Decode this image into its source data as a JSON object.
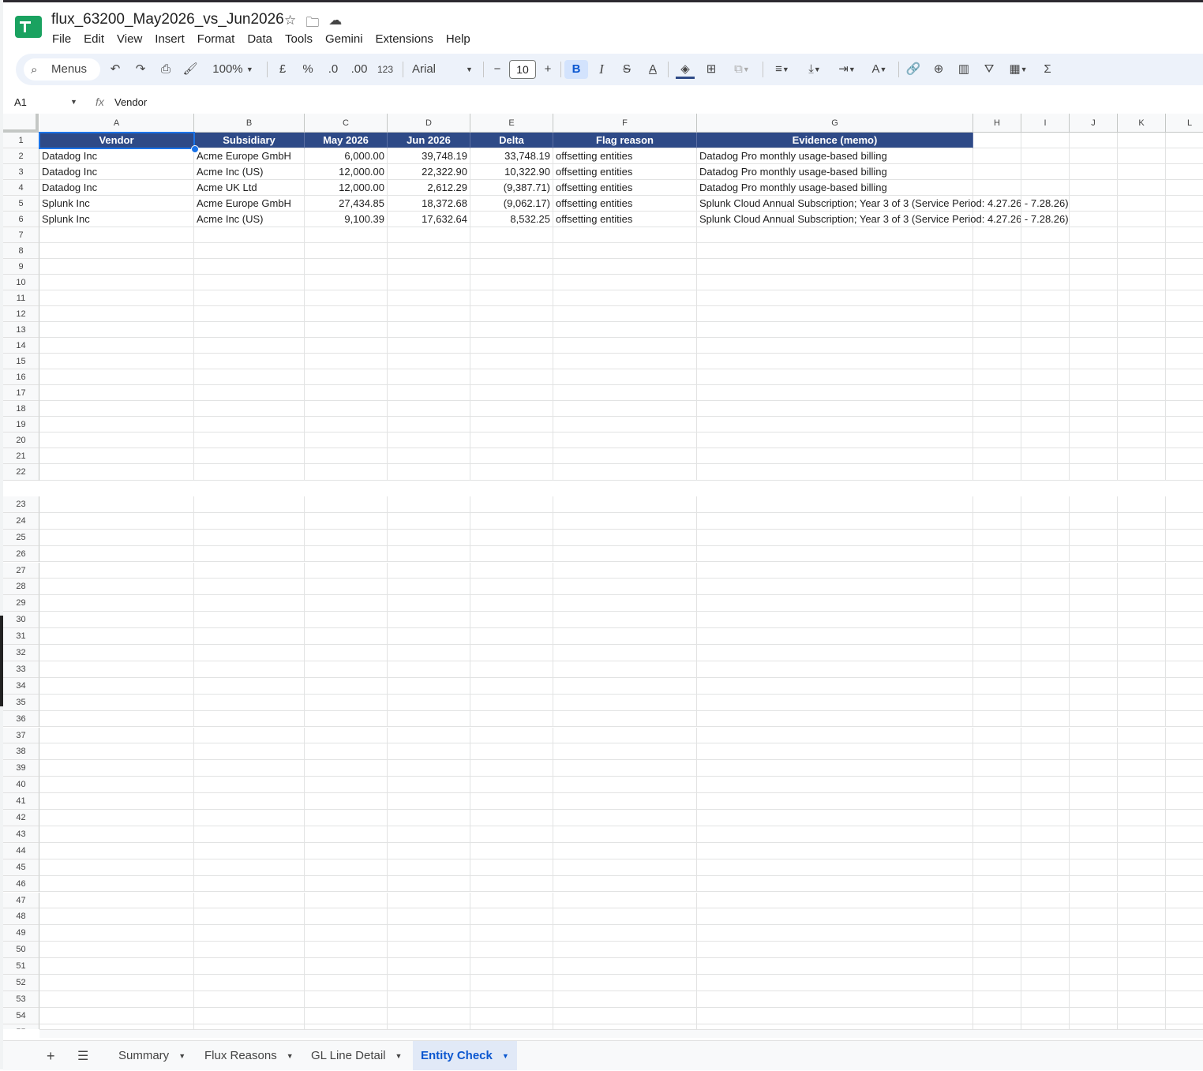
{
  "doc": {
    "title": "flux_63200_May2026_vs_Jun2026"
  },
  "menu": [
    "File",
    "Edit",
    "View",
    "Insert",
    "Format",
    "Data",
    "Tools",
    "Gemini",
    "Extensions",
    "Help"
  ],
  "toolbar": {
    "search_label": "Menus",
    "zoom": "100%",
    "currency": "£",
    "percent": "%",
    "dec_decrease": ".0",
    "dec_increase": ".00",
    "number_format": "123",
    "font": "Arial",
    "font_size": "10",
    "bold": "B",
    "italic": "I",
    "strike": "S",
    "text_color": "A"
  },
  "formula_bar": {
    "cell_ref": "A1",
    "fx": "fx",
    "value": "Vendor"
  },
  "columns": [
    "A",
    "B",
    "C",
    "D",
    "E",
    "F",
    "G",
    "H",
    "I",
    "J",
    "K",
    "L"
  ],
  "table": {
    "headers": [
      "Vendor",
      "Subsidiary",
      "May 2026",
      "Jun 2026",
      "Delta",
      "Flag reason",
      "Evidence (memo)"
    ],
    "rows": [
      [
        "Datadog Inc",
        "Acme Europe GmbH",
        "6,000.00",
        "39,748.19",
        "33,748.19",
        "offsetting entities",
        "Datadog Pro monthly usage-based billing"
      ],
      [
        "Datadog Inc",
        "Acme Inc (US)",
        "12,000.00",
        "22,322.90",
        "10,322.90",
        "offsetting entities",
        "Datadog Pro monthly usage-based billing"
      ],
      [
        "Datadog Inc",
        "Acme UK Ltd",
        "12,000.00",
        "2,612.29",
        "(9,387.71)",
        "offsetting entities",
        "Datadog Pro monthly usage-based billing"
      ],
      [
        "Splunk Inc",
        "Acme Europe GmbH",
        "27,434.85",
        "18,372.68",
        "(9,062.17)",
        "offsetting entities",
        "Splunk Cloud Annual Subscription; Year 3 of 3 (Service Period: 4.27.26 - 7.28.26)"
      ],
      [
        "Splunk Inc",
        "Acme Inc (US)",
        "9,100.39",
        "17,632.64",
        "8,532.25",
        "offsetting entities",
        "Splunk Cloud Annual Subscription; Year 3 of 3 (Service Period: 4.27.26 - 7.28.26)"
      ]
    ]
  },
  "row_count": 55,
  "sheets": [
    {
      "label": "Summary",
      "active": false
    },
    {
      "label": "Flux Reasons",
      "active": false
    },
    {
      "label": "GL Line Detail",
      "active": false
    },
    {
      "label": "Entity Check",
      "active": true
    }
  ],
  "colors": {
    "header_bg": "#2e4a87",
    "selection": "#1a73e8",
    "active_tab": "#0b57d0"
  }
}
